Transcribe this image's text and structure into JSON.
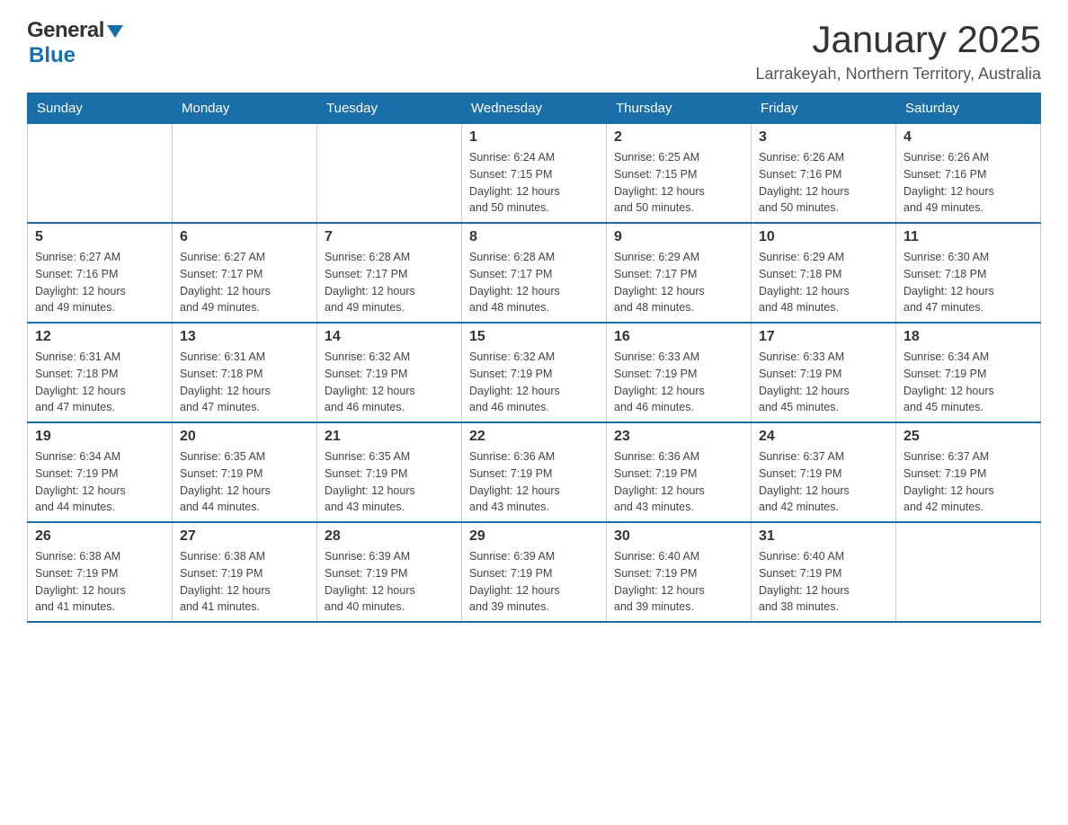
{
  "header": {
    "logo_general": "General",
    "logo_blue": "Blue",
    "month_title": "January 2025",
    "location": "Larrakeyah, Northern Territory, Australia"
  },
  "days_of_week": [
    "Sunday",
    "Monday",
    "Tuesday",
    "Wednesday",
    "Thursday",
    "Friday",
    "Saturday"
  ],
  "weeks": [
    [
      {
        "day": "",
        "info": ""
      },
      {
        "day": "",
        "info": ""
      },
      {
        "day": "",
        "info": ""
      },
      {
        "day": "1",
        "info": "Sunrise: 6:24 AM\nSunset: 7:15 PM\nDaylight: 12 hours\nand 50 minutes."
      },
      {
        "day": "2",
        "info": "Sunrise: 6:25 AM\nSunset: 7:15 PM\nDaylight: 12 hours\nand 50 minutes."
      },
      {
        "day": "3",
        "info": "Sunrise: 6:26 AM\nSunset: 7:16 PM\nDaylight: 12 hours\nand 50 minutes."
      },
      {
        "day": "4",
        "info": "Sunrise: 6:26 AM\nSunset: 7:16 PM\nDaylight: 12 hours\nand 49 minutes."
      }
    ],
    [
      {
        "day": "5",
        "info": "Sunrise: 6:27 AM\nSunset: 7:16 PM\nDaylight: 12 hours\nand 49 minutes."
      },
      {
        "day": "6",
        "info": "Sunrise: 6:27 AM\nSunset: 7:17 PM\nDaylight: 12 hours\nand 49 minutes."
      },
      {
        "day": "7",
        "info": "Sunrise: 6:28 AM\nSunset: 7:17 PM\nDaylight: 12 hours\nand 49 minutes."
      },
      {
        "day": "8",
        "info": "Sunrise: 6:28 AM\nSunset: 7:17 PM\nDaylight: 12 hours\nand 48 minutes."
      },
      {
        "day": "9",
        "info": "Sunrise: 6:29 AM\nSunset: 7:17 PM\nDaylight: 12 hours\nand 48 minutes."
      },
      {
        "day": "10",
        "info": "Sunrise: 6:29 AM\nSunset: 7:18 PM\nDaylight: 12 hours\nand 48 minutes."
      },
      {
        "day": "11",
        "info": "Sunrise: 6:30 AM\nSunset: 7:18 PM\nDaylight: 12 hours\nand 47 minutes."
      }
    ],
    [
      {
        "day": "12",
        "info": "Sunrise: 6:31 AM\nSunset: 7:18 PM\nDaylight: 12 hours\nand 47 minutes."
      },
      {
        "day": "13",
        "info": "Sunrise: 6:31 AM\nSunset: 7:18 PM\nDaylight: 12 hours\nand 47 minutes."
      },
      {
        "day": "14",
        "info": "Sunrise: 6:32 AM\nSunset: 7:19 PM\nDaylight: 12 hours\nand 46 minutes."
      },
      {
        "day": "15",
        "info": "Sunrise: 6:32 AM\nSunset: 7:19 PM\nDaylight: 12 hours\nand 46 minutes."
      },
      {
        "day": "16",
        "info": "Sunrise: 6:33 AM\nSunset: 7:19 PM\nDaylight: 12 hours\nand 46 minutes."
      },
      {
        "day": "17",
        "info": "Sunrise: 6:33 AM\nSunset: 7:19 PM\nDaylight: 12 hours\nand 45 minutes."
      },
      {
        "day": "18",
        "info": "Sunrise: 6:34 AM\nSunset: 7:19 PM\nDaylight: 12 hours\nand 45 minutes."
      }
    ],
    [
      {
        "day": "19",
        "info": "Sunrise: 6:34 AM\nSunset: 7:19 PM\nDaylight: 12 hours\nand 44 minutes."
      },
      {
        "day": "20",
        "info": "Sunrise: 6:35 AM\nSunset: 7:19 PM\nDaylight: 12 hours\nand 44 minutes."
      },
      {
        "day": "21",
        "info": "Sunrise: 6:35 AM\nSunset: 7:19 PM\nDaylight: 12 hours\nand 43 minutes."
      },
      {
        "day": "22",
        "info": "Sunrise: 6:36 AM\nSunset: 7:19 PM\nDaylight: 12 hours\nand 43 minutes."
      },
      {
        "day": "23",
        "info": "Sunrise: 6:36 AM\nSunset: 7:19 PM\nDaylight: 12 hours\nand 43 minutes."
      },
      {
        "day": "24",
        "info": "Sunrise: 6:37 AM\nSunset: 7:19 PM\nDaylight: 12 hours\nand 42 minutes."
      },
      {
        "day": "25",
        "info": "Sunrise: 6:37 AM\nSunset: 7:19 PM\nDaylight: 12 hours\nand 42 minutes."
      }
    ],
    [
      {
        "day": "26",
        "info": "Sunrise: 6:38 AM\nSunset: 7:19 PM\nDaylight: 12 hours\nand 41 minutes."
      },
      {
        "day": "27",
        "info": "Sunrise: 6:38 AM\nSunset: 7:19 PM\nDaylight: 12 hours\nand 41 minutes."
      },
      {
        "day": "28",
        "info": "Sunrise: 6:39 AM\nSunset: 7:19 PM\nDaylight: 12 hours\nand 40 minutes."
      },
      {
        "day": "29",
        "info": "Sunrise: 6:39 AM\nSunset: 7:19 PM\nDaylight: 12 hours\nand 39 minutes."
      },
      {
        "day": "30",
        "info": "Sunrise: 6:40 AM\nSunset: 7:19 PM\nDaylight: 12 hours\nand 39 minutes."
      },
      {
        "day": "31",
        "info": "Sunrise: 6:40 AM\nSunset: 7:19 PM\nDaylight: 12 hours\nand 38 minutes."
      },
      {
        "day": "",
        "info": ""
      }
    ]
  ]
}
